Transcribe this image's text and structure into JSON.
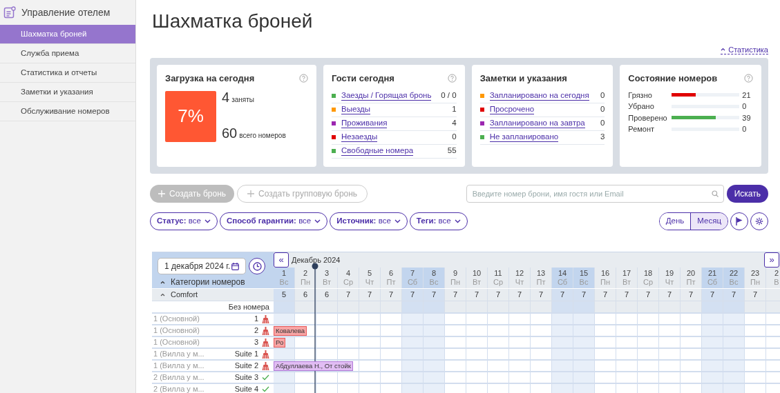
{
  "sidebar": {
    "title": "Управление отелем",
    "items": [
      {
        "label": "Шахматка броней",
        "selected": true
      },
      {
        "label": "Служба приема",
        "selected": false
      },
      {
        "label": "Статистика и отчеты",
        "selected": false
      },
      {
        "label": "Заметки и указания",
        "selected": false
      },
      {
        "label": "Обслуживание номеров",
        "selected": false
      }
    ]
  },
  "page_title": "Шахматка броней",
  "stats_link": "Статистика",
  "load_card": {
    "title": "Загрузка на сегодня",
    "percent": "7%",
    "occupied": "4",
    "occupied_label": "заняты",
    "total": "60",
    "total_label": "всего номеров"
  },
  "guests_card": {
    "title": "Гости сегодня",
    "items": [
      {
        "label": "Заезды / Горящая бронь",
        "value": "0 / 0",
        "color": "#4caf50"
      },
      {
        "label": "Выезды",
        "value": "1",
        "color": "#ff9800"
      },
      {
        "label": "Проживания",
        "value": "4",
        "color": "#9c27b0"
      },
      {
        "label": "Незаезды",
        "value": "0",
        "color": "#e00000"
      },
      {
        "label": "Свободные номера",
        "value": "55",
        "color": "#4caf50"
      }
    ]
  },
  "notes_card": {
    "title": "Заметки и указания",
    "items": [
      {
        "label": "Запланировано на сегодня",
        "value": "0",
        "color": "#ff9800"
      },
      {
        "label": "Просрочено",
        "value": "0",
        "color": "#e00000"
      },
      {
        "label": "Запланировано на завтра",
        "value": "0",
        "color": "#9c27b0"
      },
      {
        "label": "Не запланировано",
        "value": "3",
        "color": "#4caf50"
      }
    ]
  },
  "rooms_card": {
    "title": "Состояние номеров",
    "items": [
      {
        "label": "Грязно",
        "value": "21",
        "level": 0.35,
        "color": "#e00000"
      },
      {
        "label": "Убрано",
        "value": "0"
      },
      {
        "label": "Проверено",
        "value": "39",
        "level": 0.65,
        "color": "#4caf50"
      },
      {
        "label": "Ремонт",
        "value": "0"
      }
    ]
  },
  "actions": {
    "create": "Создать бронь",
    "create_group": "Создать групповую бронь",
    "search_placeholder": "Введите номер брони, имя гостя или Email",
    "search_button": "Искать"
  },
  "filters": [
    {
      "label": "Статус:",
      "value": "все"
    },
    {
      "label": "Способ гарантии:",
      "value": "все"
    },
    {
      "label": "Источник:",
      "value": "все"
    },
    {
      "label": "Теги:",
      "value": "все"
    }
  ],
  "views": [
    {
      "label": "День",
      "selected": false
    },
    {
      "label": "Месяц",
      "selected": true
    }
  ],
  "calendar": {
    "date": "1 декабря 2024 г.",
    "categories_label": "Категории номеров",
    "month": "Декабрь 2024",
    "prev": "«",
    "next": "»",
    "days": [
      {
        "day": "1",
        "weekday": "Вс",
        "count": "5",
        "weekend": true
      },
      {
        "day": "2",
        "weekday": "Пн",
        "count": "6",
        "weekend": false
      },
      {
        "day": "3",
        "weekday": "Вт",
        "count": "6",
        "weekend": false
      },
      {
        "day": "4",
        "weekday": "Ср",
        "count": "7",
        "weekend": false
      },
      {
        "day": "5",
        "weekday": "Чт",
        "count": "7",
        "weekend": false
      },
      {
        "day": "6",
        "weekday": "Пт",
        "count": "7",
        "weekend": false
      },
      {
        "day": "7",
        "weekday": "Сб",
        "count": "7",
        "weekend": true
      },
      {
        "day": "8",
        "weekday": "Вс",
        "count": "7",
        "weekend": true
      },
      {
        "day": "9",
        "weekday": "Пн",
        "count": "7",
        "weekend": false
      },
      {
        "day": "10",
        "weekday": "Вт",
        "count": "7",
        "weekend": false
      },
      {
        "day": "11",
        "weekday": "Ср",
        "count": "7",
        "weekend": false
      },
      {
        "day": "12",
        "weekday": "Чт",
        "count": "7",
        "weekend": false
      },
      {
        "day": "13",
        "weekday": "Пт",
        "count": "7",
        "weekend": false
      },
      {
        "day": "14",
        "weekday": "Сб",
        "count": "7",
        "weekend": true
      },
      {
        "day": "15",
        "weekday": "Вс",
        "count": "7",
        "weekend": true
      },
      {
        "day": "16",
        "weekday": "Пн",
        "count": "7",
        "weekend": false
      },
      {
        "day": "17",
        "weekday": "Вт",
        "count": "7",
        "weekend": false
      },
      {
        "day": "18",
        "weekday": "Ср",
        "count": "7",
        "weekend": false
      },
      {
        "day": "19",
        "weekday": "Чт",
        "count": "7",
        "weekend": false
      },
      {
        "day": "20",
        "weekday": "Пт",
        "count": "7",
        "weekend": false
      },
      {
        "day": "21",
        "weekday": "Сб",
        "count": "7",
        "weekend": true
      },
      {
        "day": "22",
        "weekday": "Вс",
        "count": "7",
        "weekend": true
      },
      {
        "day": "23",
        "weekday": "Пн",
        "count": "7",
        "weekend": false
      },
      {
        "day": "2",
        "weekday": "В",
        "weekend": false
      }
    ],
    "category": {
      "name": "Comfort",
      "expanded": true
    },
    "unassigned": "Без номера",
    "rooms": [
      {
        "type": "1 (Основной)",
        "number": "1",
        "clean": false
      },
      {
        "type": "1 (Основной)",
        "number": "2",
        "clean": false,
        "booking": {
          "label": "Ковалева",
          "color": "#f8a5a5"
        }
      },
      {
        "type": "1 (Основной)",
        "number": "3",
        "clean": false,
        "booking": {
          "label": "Ро",
          "color": "#f8a5a5"
        }
      },
      {
        "type": "1 (Вилла у м...",
        "number": "Suite 1",
        "clean": false
      },
      {
        "type": "1 (Вилла у м...",
        "number": "Suite 2",
        "clean": false,
        "booking": {
          "label": "Абдуллаева Н., От стойк",
          "color": "#e1bdf3"
        }
      },
      {
        "type": "2 (Вилла у м...",
        "number": "Suite 3",
        "clean": true
      },
      {
        "type": "2 (Вилла у м...",
        "number": "Suite 4",
        "clean": true
      }
    ]
  }
}
